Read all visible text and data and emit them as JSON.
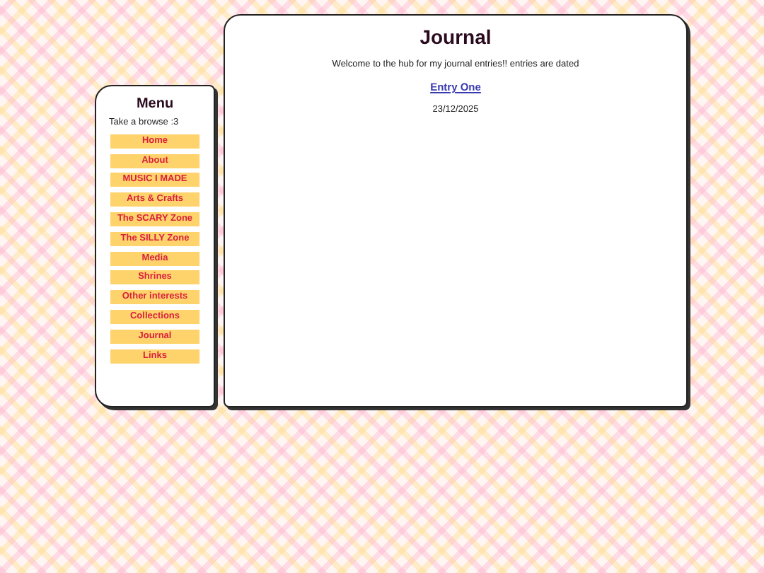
{
  "menu": {
    "title": "Menu",
    "intro": "Take a browse :3",
    "items": [
      {
        "label": "Home"
      },
      {
        "label": "About"
      },
      {
        "label": "MUSIC I MADE"
      },
      {
        "label": "Arts & Crafts"
      },
      {
        "label": "The SCARY Zone"
      },
      {
        "label": "The SILLY Zone"
      },
      {
        "label": "Media"
      },
      {
        "label": "Shrines"
      },
      {
        "label": "Other interests"
      },
      {
        "label": "Collections"
      },
      {
        "label": "Journal"
      },
      {
        "label": "Links"
      }
    ]
  },
  "main": {
    "title": "Journal",
    "intro": "Welcome to the hub for my journal entries!! entries are dated",
    "entries": [
      {
        "link": "Entry One",
        "date": "23/12/2025"
      }
    ]
  }
}
